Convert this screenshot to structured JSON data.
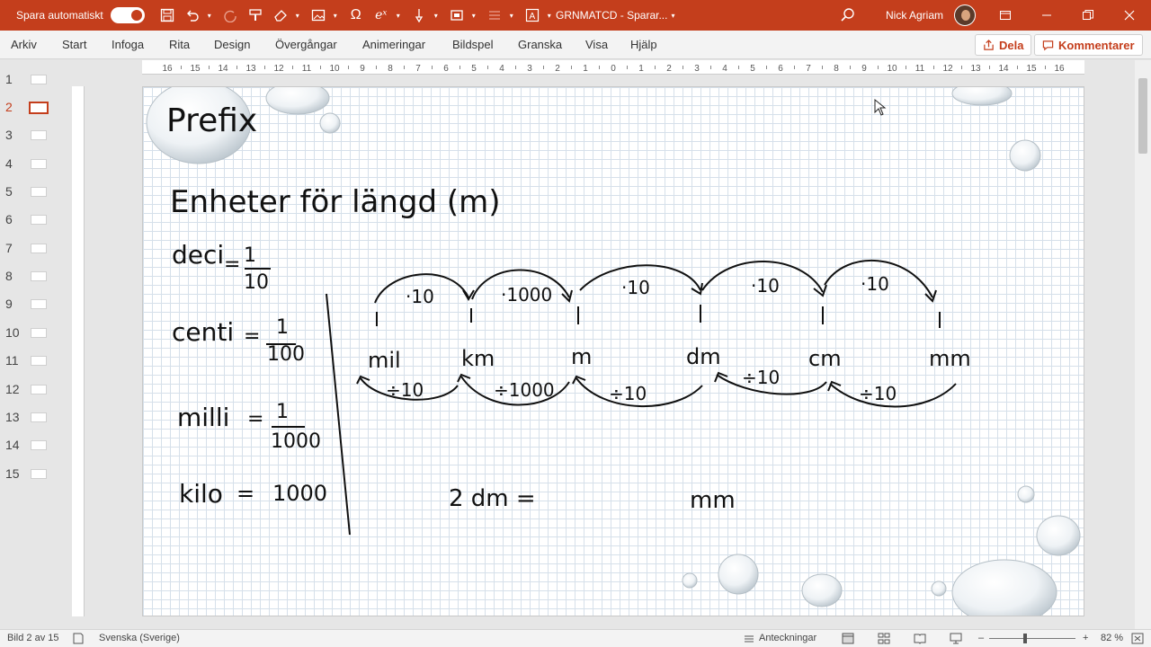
{
  "titlebar": {
    "autosave_label": "Spara automatiskt",
    "autosave_state": "on",
    "document_title": "GRNMATCD - Sparar...",
    "user_name": "Nick Agriam",
    "brand_color": "#c43e1c"
  },
  "ribbon": {
    "tabs": [
      "Arkiv",
      "Start",
      "Infoga",
      "Rita",
      "Design",
      "Övergångar",
      "Animeringar",
      "Bildspel",
      "Granska",
      "Visa",
      "Hjälp"
    ],
    "share_label": "Dela",
    "comments_label": "Kommentarer"
  },
  "thumbnails": {
    "numbers": [
      "1",
      "2",
      "3",
      "4",
      "5",
      "6",
      "7",
      "8",
      "9",
      "10",
      "11",
      "12",
      "13",
      "14",
      "15"
    ],
    "active_index": 2
  },
  "ruler": {
    "labels": [
      "16",
      "15",
      "14",
      "13",
      "12",
      "11",
      "10",
      "9",
      "8",
      "7",
      "6",
      "5",
      "4",
      "3",
      "2",
      "1",
      "0",
      "1",
      "2",
      "3",
      "4",
      "5",
      "6",
      "7",
      "8",
      "9",
      "10",
      "11",
      "12",
      "13",
      "14",
      "15",
      "16"
    ]
  },
  "slide": {
    "title": "Prefix",
    "heading": "Enheter för längd (m)",
    "prefixes": [
      {
        "name": "deci",
        "value": "1/10"
      },
      {
        "name": "centi",
        "value": "1/100"
      },
      {
        "name": "milli",
        "value": "1/1000"
      },
      {
        "name": "kilo",
        "value": "1000"
      }
    ],
    "units": [
      "mil",
      "km",
      "m",
      "dm",
      "cm",
      "mm"
    ],
    "top_ops": [
      "·10",
      "·1000",
      "·10",
      "·10",
      "·10"
    ],
    "bottom_ops": [
      "÷10",
      "÷1000",
      "÷10",
      "÷10",
      "÷10"
    ],
    "exercise_left": "2 dm =",
    "exercise_right": "mm"
  },
  "statusbar": {
    "slide_info": "Bild 2 av 15",
    "language": "Svenska (Sverige)",
    "notes_label": "Anteckningar",
    "zoom": "82 %",
    "zoom_minus": "–",
    "zoom_plus": "+"
  }
}
